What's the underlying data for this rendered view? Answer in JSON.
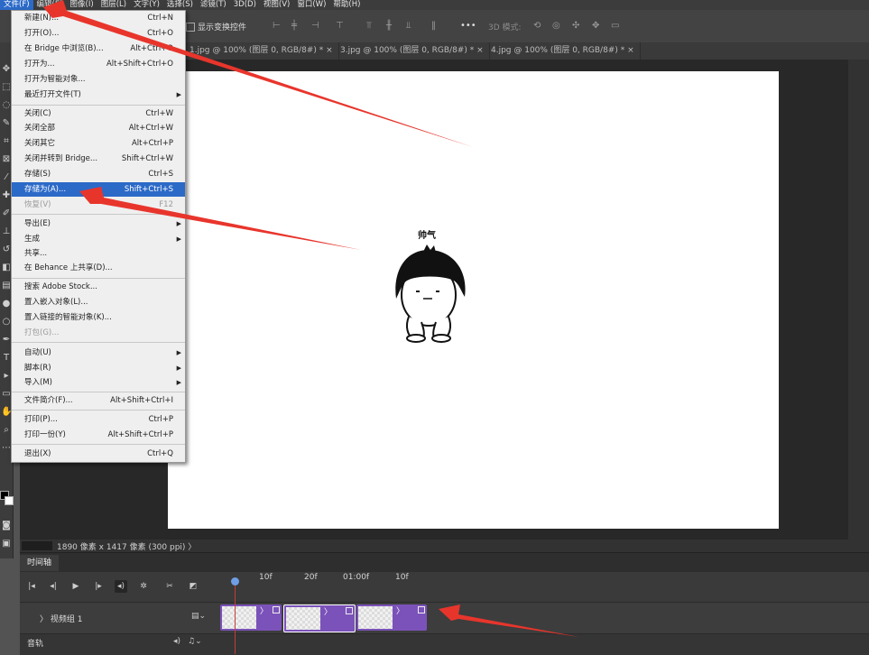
{
  "menubar": [
    "文件(F)",
    "编辑(E)",
    "图像(I)",
    "图层(L)",
    "文字(Y)",
    "选择(S)",
    "滤镜(T)",
    "3D(D)",
    "视图(V)",
    "窗口(W)",
    "帮助(H)"
  ],
  "options_bar": {
    "show_transform": "显示变换控件",
    "mode_3d": "3D 模式:",
    "more": "•••"
  },
  "tabs": [
    "1.jpg @ 100% (图层 0, RGB/8#) *",
    "3.jpg @ 100% (图层 0, RGB/8#) *",
    "4.jpg @ 100% (图层 0, RGB/8#) *"
  ],
  "tab_close": "×",
  "file_menu": [
    {
      "label": "新建(N)...",
      "shortcut": "Ctrl+N"
    },
    {
      "label": "打开(O)...",
      "shortcut": "Ctrl+O"
    },
    {
      "label": "在 Bridge 中浏览(B)...",
      "shortcut": "Alt+Ctrl+O"
    },
    {
      "label": "打开为...",
      "shortcut": "Alt+Shift+Ctrl+O"
    },
    {
      "label": "打开为智能对象...",
      "shortcut": ""
    },
    {
      "label": "最近打开文件(T)",
      "shortcut": "",
      "sub": true
    },
    {
      "label": "关闭(C)",
      "shortcut": "Ctrl+W"
    },
    {
      "label": "关闭全部",
      "shortcut": "Alt+Ctrl+W"
    },
    {
      "label": "关闭其它",
      "shortcut": "Alt+Ctrl+P"
    },
    {
      "label": "关闭并转到 Bridge...",
      "shortcut": "Shift+Ctrl+W"
    },
    {
      "label": "存储(S)",
      "shortcut": "Ctrl+S"
    },
    {
      "label": "存储为(A)...",
      "shortcut": "Shift+Ctrl+S",
      "highlight": true
    },
    {
      "label": "恢复(V)",
      "shortcut": "F12",
      "disabled": true
    },
    {
      "label": "导出(E)",
      "shortcut": "",
      "sub": true
    },
    {
      "label": "生成",
      "shortcut": "",
      "sub": true
    },
    {
      "label": "共享...",
      "shortcut": ""
    },
    {
      "label": "在 Behance 上共享(D)...",
      "shortcut": ""
    },
    {
      "label": "搜索 Adobe Stock...",
      "shortcut": ""
    },
    {
      "label": "置入嵌入对象(L)...",
      "shortcut": ""
    },
    {
      "label": "置入链接的智能对象(K)...",
      "shortcut": ""
    },
    {
      "label": "打包(G)...",
      "shortcut": "",
      "disabled": true
    },
    {
      "label": "自动(U)",
      "shortcut": "",
      "sub": true
    },
    {
      "label": "脚本(R)",
      "shortcut": "",
      "sub": true
    },
    {
      "label": "导入(M)",
      "shortcut": "",
      "sub": true
    },
    {
      "label": "文件简介(F)...",
      "shortcut": "Alt+Shift+Ctrl+I"
    },
    {
      "label": "打印(P)...",
      "shortcut": "Ctrl+P"
    },
    {
      "label": "打印一份(Y)",
      "shortcut": "Alt+Shift+Ctrl+P"
    },
    {
      "label": "退出(X)",
      "shortcut": "Ctrl+Q"
    }
  ],
  "canvas": {
    "caption": "帅气"
  },
  "status": "1890 像素 x 1417 像素 (300 ppi)  〉",
  "timeline": {
    "title": "时间轴",
    "ruler": [
      "10f",
      "20f",
      "01:00f",
      "10f"
    ],
    "track_name": "〉 视频组 1",
    "audio_name": "音轨"
  }
}
